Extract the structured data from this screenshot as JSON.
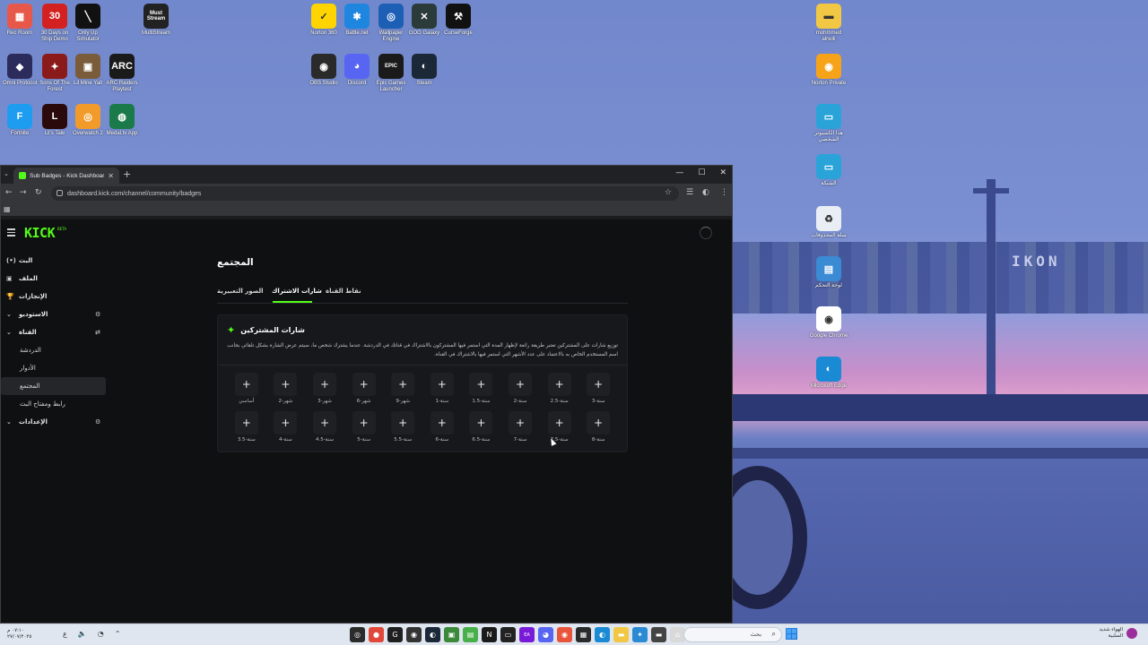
{
  "desktop": {
    "icons": [
      {
        "label": "Rec Room",
        "icon": "rec-room-icon",
        "color": "#e8584a",
        "glyph": "▦"
      },
      {
        "label": "30 Days on Ship Demo",
        "icon": "30days-icon",
        "color": "#d32121",
        "glyph": "30"
      },
      {
        "label": "Only Up Simulator",
        "icon": "onlyup-icon",
        "color": "#111111",
        "glyph": "╲"
      },
      {
        "label": "MultiStream",
        "icon": "multistream-icon",
        "color": "#222222",
        "glyph": "Must Stream"
      },
      {
        "label": "Norton 360",
        "icon": "norton-icon",
        "color": "#ffd400",
        "glyph": "✓"
      },
      {
        "label": "Battle.net",
        "icon": "battlenet-icon",
        "color": "#1f86e0",
        "glyph": "✱"
      },
      {
        "label": "Wallpaper Engine",
        "icon": "wallpaper-engine-icon",
        "color": "#1c5fb5",
        "glyph": "◎"
      },
      {
        "label": "GOG Galaxy",
        "icon": "gog-icon",
        "color": "#2a3b3a",
        "glyph": "✕"
      },
      {
        "label": "CurseForge",
        "icon": "curseforge-icon",
        "color": "#111111",
        "glyph": "⚒"
      },
      {
        "label": "Omni Protocol",
        "icon": "omni-icon",
        "color": "#2b2b5c",
        "glyph": "◆"
      },
      {
        "label": "Sons Of The Forest",
        "icon": "sotf-icon",
        "color": "#8b1a1a",
        "glyph": "✦"
      },
      {
        "label": "Lil Mine Yall",
        "icon": "lilmine-icon",
        "color": "#7a5b3a",
        "glyph": "▣"
      },
      {
        "label": "ARC Raiders Playtest",
        "icon": "arc-icon",
        "color": "#1a1a1a",
        "glyph": "ARC"
      },
      {
        "label": "OBS Studio",
        "icon": "obs-icon",
        "color": "#2a2a2a",
        "glyph": "◉"
      },
      {
        "label": "Discord",
        "icon": "discord-icon",
        "color": "#5865f2",
        "glyph": "◕"
      },
      {
        "label": "Epic Games Launcher",
        "icon": "epic-icon",
        "color": "#1a1a1a",
        "glyph": "EPIC"
      },
      {
        "label": "Steam",
        "icon": "steam-icon",
        "color": "#1b2838",
        "glyph": "◐"
      },
      {
        "label": "Fortnite",
        "icon": "fortnite-icon",
        "color": "#1e9cf0",
        "glyph": "F"
      },
      {
        "label": "Lil's Tale",
        "icon": "lilstale-icon",
        "color": "#2a0a0a",
        "glyph": "L"
      },
      {
        "label": "Overwatch 2",
        "icon": "overwatch-icon",
        "color": "#f29b2b",
        "glyph": "◎"
      },
      {
        "label": "Medal.tv App",
        "icon": "medal-icon",
        "color": "#1a7a4a",
        "glyph": "◍"
      },
      {
        "label": "mohmmed alrwili",
        "icon": "user-folder-icon",
        "color": "#f2c744",
        "glyph": "▬"
      },
      {
        "label": "Norton Private",
        "icon": "norton-private-icon",
        "color": "#f7a31a",
        "glyph": "◉"
      },
      {
        "label": "هذا الكمبيوتر الشخصي",
        "icon": "this-pc-icon",
        "color": "#2aa3d9",
        "glyph": "▭"
      },
      {
        "label": "الشبكة",
        "icon": "network-icon",
        "color": "#2aa3d9",
        "glyph": "▭"
      },
      {
        "label": "سلة المحذوفات",
        "icon": "recycle-bin-icon",
        "color": "#e9eef5",
        "glyph": "♻"
      },
      {
        "label": "لوحة التحكم",
        "icon": "control-panel-icon",
        "color": "#3a8ad4",
        "glyph": "▤"
      },
      {
        "label": "Google Chrome",
        "icon": "chrome-icon",
        "color": "#ffffff",
        "glyph": "◉"
      },
      {
        "label": "Microsoft Edge",
        "icon": "edge-icon",
        "color": "#1a8ad4",
        "glyph": "◐"
      }
    ]
  },
  "browser": {
    "tab_title": "Sub Badges - Kick Dashboard",
    "url": "dashboard.kick.com/channel/community/badges"
  },
  "kick": {
    "logo": "KICK",
    "beta": "BETA",
    "sidebar": [
      {
        "label": "البث",
        "icon": "live-icon",
        "glyph": "(•)",
        "type": "item"
      },
      {
        "label": "الملف",
        "icon": "file-icon",
        "glyph": "▣",
        "type": "item"
      },
      {
        "label": "الإنجازات",
        "icon": "trophy-icon",
        "glyph": "🏆",
        "type": "item"
      },
      {
        "label": "الاستوديو",
        "icon": "chevron-down-icon",
        "glyph": "⌄",
        "right": "⚙",
        "type": "group"
      },
      {
        "label": "القناة",
        "icon": "chevron-down-icon",
        "glyph": "⌄",
        "right": "⇄",
        "type": "group"
      },
      {
        "label": "الدردشة",
        "type": "sub"
      },
      {
        "label": "الأدوار",
        "type": "sub"
      },
      {
        "label": "المجتمع",
        "type": "sub",
        "active": true
      },
      {
        "label": "رابط ومفتاح البث",
        "type": "sub"
      },
      {
        "label": "الإعدادات",
        "icon": "chevron-down-icon",
        "glyph": "⌄",
        "right": "⚙",
        "type": "group"
      }
    ],
    "page_title": "المجتمع",
    "tabs": [
      {
        "label": "الصور التعبيرية",
        "active": false
      },
      {
        "label": "شارات الاشتراك",
        "active": true
      },
      {
        "label": "نقاط القناة",
        "active": false
      }
    ],
    "card": {
      "title": "شارات المشتركين",
      "description": "توزيع شارات على المشتركين تعتبر طريقة رائعة لإظهار المدة التي استمر فيها المشتركون بالاشتراك في قناتك في الدردشة. عندما يشترك شخص ما، سيتم عرض الشارة بشكل تلقائي بجانب اسم المستخدم الخاص به بالاعتماد على عدد الأشهر التي استمر فيها بالاشتراك في القناة.",
      "badges": [
        "أساسي",
        "شهر-2",
        "شهر-3",
        "شهر-6",
        "شهر-9",
        "سنة-1",
        "سنة-1.5",
        "سنة-2",
        "سنة-2.5",
        "سنة-3",
        "سنة-3.5",
        "سنة-4",
        "سنة-4.5",
        "سنة-5",
        "سنة-5.5",
        "سنة-6",
        "سنة-6.5",
        "سنة-7",
        "سنة-7.5",
        "سنة-8"
      ]
    }
  },
  "taskbar": {
    "time": "٠٧:١٠ م",
    "date": "٢٧/٠٧/٢٠٢٥",
    "lang": "ع",
    "search_placeholder": "بحث",
    "weather_title": "الهواء شديد",
    "weather_sub": "السلبية"
  }
}
